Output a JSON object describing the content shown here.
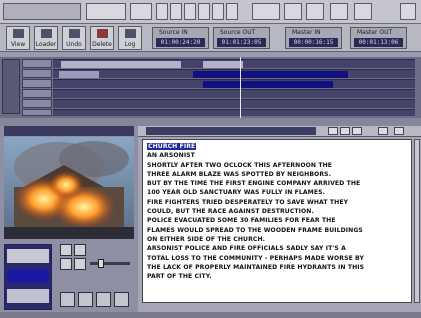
{
  "toolbar": {
    "tools": [
      {
        "id": "view",
        "label": "View",
        "icon": "view-icon"
      },
      {
        "id": "loader",
        "label": "Loader",
        "icon": "loader-icon"
      },
      {
        "id": "undo",
        "label": "Undo",
        "icon": "undo-icon"
      },
      {
        "id": "delete",
        "label": "Delete",
        "icon": "delete-icon"
      },
      {
        "id": "log",
        "label": "Log",
        "icon": "log-icon"
      }
    ],
    "timecodes": [
      {
        "label": "Source IN",
        "value": "01:00:24:20"
      },
      {
        "label": "Source OUT",
        "value": "01:01:23:05"
      },
      {
        "label": "Master IN",
        "value": "00:00:16:15"
      },
      {
        "label": "Master OUT",
        "value": "00:01:13:06"
      }
    ]
  },
  "document": {
    "title": "CHURCH FIRE",
    "lines": [
      "AN ARSONIST",
      "SHORTLY AFTER TWO OCLOCK THIS AFTERNOON THE",
      "THREE ALARM BLAZE WAS SPOTTED BY NEIGHBORS.",
      "BUT BY THE TIME THE FIRST ENGINE COMPANY ARRIVED THE",
      "100 YEAR OLD SANCTUARY WAS FULLY IN FLAMES.",
      "FIRE FIGHTERS TRIED DESPERATELY TO SAVE WHAT THEY",
      "COULD, BUT THE RACE AGAINST DESTRUCTION.",
      "POLICE EVACUATED SOME 30 FAMILIES FOR FEAR THE",
      "FLAMES WOULD SPREAD TO THE WOODEN FRAME BUILDINGS",
      "ON EITHER SIDE OF THE CHURCH.",
      "ARSONIST POLICE AND FIRE OFFICIALS SADLY SAY IT'S A",
      "TOTAL LOSS TO THE COMMUNITY - PERHAPS MADE WORSE BY",
      "THE LACK OF PROPERLY MAINTAINED FIRE HYDRANTS IN THIS",
      "PART OF THE CITY."
    ]
  },
  "colors": {
    "timeline_bg": "#6d6d86",
    "clip_highlight": "#101080",
    "doc_highlight": "#1e2a9c"
  }
}
